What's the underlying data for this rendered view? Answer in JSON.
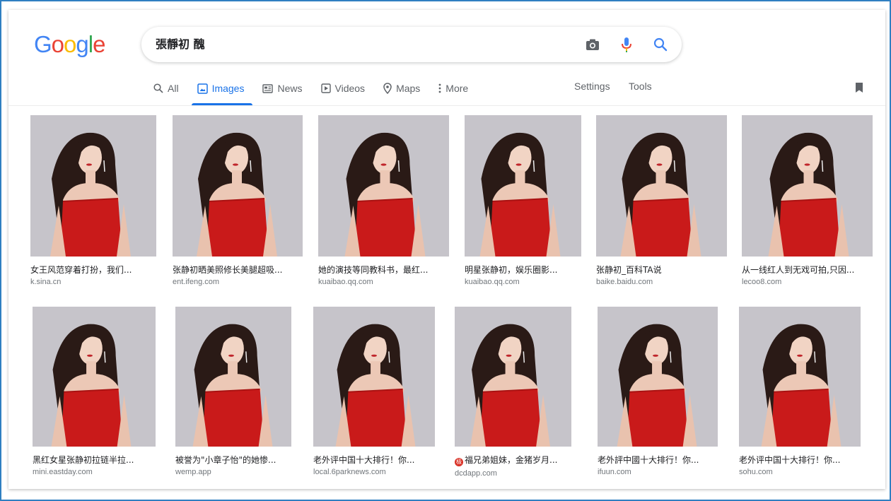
{
  "logo": {
    "letters": [
      "G",
      "o",
      "o",
      "g",
      "l",
      "e"
    ],
    "colors": [
      "#4285f4",
      "#ea4335",
      "#fbbc05",
      "#4285f4",
      "#34a853",
      "#ea4335"
    ]
  },
  "search": {
    "query": "張靜初 醜",
    "icons": [
      "camera-icon",
      "microphone-icon",
      "search-icon"
    ]
  },
  "tabs": [
    {
      "label": "All",
      "icon": "search-icon",
      "active": false
    },
    {
      "label": "Images",
      "icon": "image-icon",
      "active": true
    },
    {
      "label": "News",
      "icon": "newspaper-icon",
      "active": false
    },
    {
      "label": "Videos",
      "icon": "play-icon",
      "active": false
    },
    {
      "label": "Maps",
      "icon": "map-pin-icon",
      "active": false
    },
    {
      "label": "More",
      "icon": "more-vert-icon",
      "active": false
    }
  ],
  "tools": {
    "settings": "Settings",
    "tools": "Tools",
    "collections_icon": "bookmark-icon"
  },
  "colors": {
    "accent": "#1a73e8",
    "dress": "#c91a1a",
    "background": "#c5c3c8"
  },
  "results": [
    {
      "title": "女王风范穿着打扮，我们...",
      "source": "k.sina.cn"
    },
    {
      "title": "张静初晒美照修长美腿超吸...",
      "source": "ent.ifeng.com"
    },
    {
      "title": "她的演技等同教科书，最红...",
      "source": "kuaibao.qq.com"
    },
    {
      "title": "明星张静初，娱乐圈影...",
      "source": "kuaibao.qq.com"
    },
    {
      "title": "张静初_百科TA说",
      "source": "baike.baidu.com"
    },
    {
      "title": "从一线红人到无戏可拍,只因...",
      "source": "lecoo8.com"
    },
    {
      "title": "黑红女星张静初拉链半拉...",
      "source": "mini.eastday.com"
    },
    {
      "title": "被誉为\"小章子怡\"的她惨...",
      "source": "wemp.app"
    },
    {
      "title": "老外评中国十大排行！你...",
      "source": "local.6parknews.com"
    },
    {
      "title": "福兄弟姐妹，金猪岁月...",
      "source": "dcdapp.com",
      "badge": "极"
    },
    {
      "title": "老外評中國十大排行！你...",
      "source": "ifuun.com"
    },
    {
      "title": "老外评中国十大排行！你...",
      "source": "sohu.com"
    }
  ]
}
